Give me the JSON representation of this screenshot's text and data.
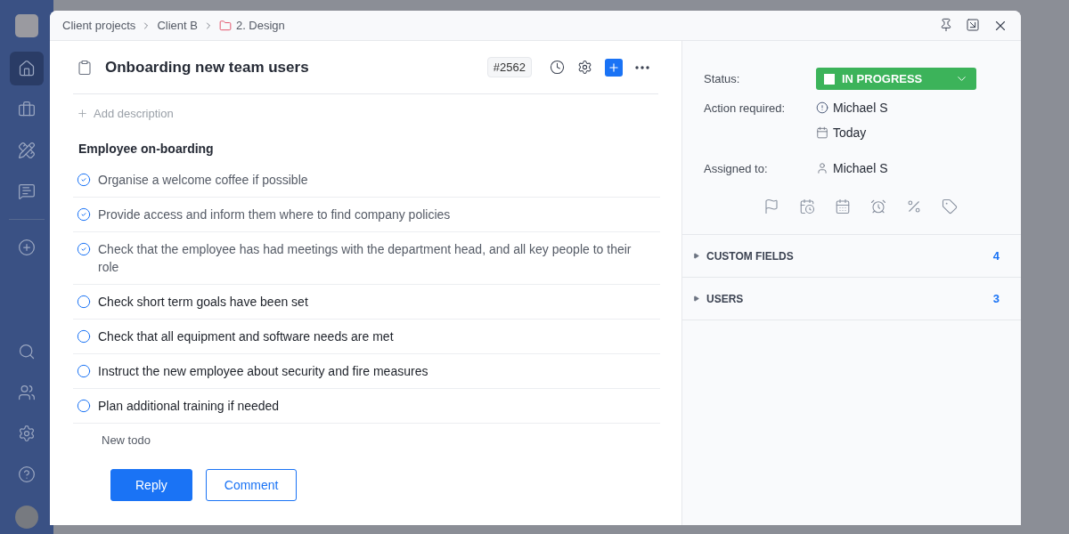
{
  "sidebar": {
    "nav": [
      {
        "selected": true
      },
      {
        "selected": false
      },
      {
        "selected": false
      },
      {
        "selected": false
      }
    ]
  },
  "breadcrumb": [
    {
      "label": "Client projects",
      "kind": "link"
    },
    {
      "label": "Client B",
      "kind": "link"
    },
    {
      "label": "2. Design",
      "kind": "folder"
    }
  ],
  "task": {
    "title": "Onboarding new team users",
    "number": "#2562",
    "add_description": "Add description",
    "checklist": {
      "title": "Employee on-boarding",
      "todos": [
        {
          "text": "Organise a welcome coffee if possible",
          "checked": true
        },
        {
          "text": "Provide access and inform them where to find company policies",
          "checked": true
        },
        {
          "text": "Check that the employee has had meetings with the department head, and all key people to their role",
          "checked": true
        },
        {
          "text": "Check short term goals have been set",
          "checked": false
        },
        {
          "text": "Check that all equipment and software needs are met",
          "checked": false
        },
        {
          "text": "Instruct the new employee about security and fire measures",
          "checked": false
        },
        {
          "text": "Plan additional training if needed",
          "checked": false
        }
      ],
      "new_todo": {
        "placeholder": "New todo"
      }
    },
    "buttons": [
      {
        "label": "Reply",
        "kind": "primary"
      },
      {
        "label": "Comment",
        "kind": "secondary"
      }
    ]
  },
  "details": {
    "status": {
      "label": "Status:",
      "value": "IN PROGRESS",
      "color": "#3cb35a"
    },
    "action_required": {
      "label": "Action required:",
      "person": "Michael S",
      "date": "Today"
    },
    "assigned": {
      "label": "Assigned to:",
      "person": "Michael S"
    },
    "sections": [
      {
        "title": "CUSTOM FIELDS",
        "count": "4",
        "expanded": false
      },
      {
        "title": "USERS",
        "count": "3",
        "expanded": false
      }
    ]
  }
}
